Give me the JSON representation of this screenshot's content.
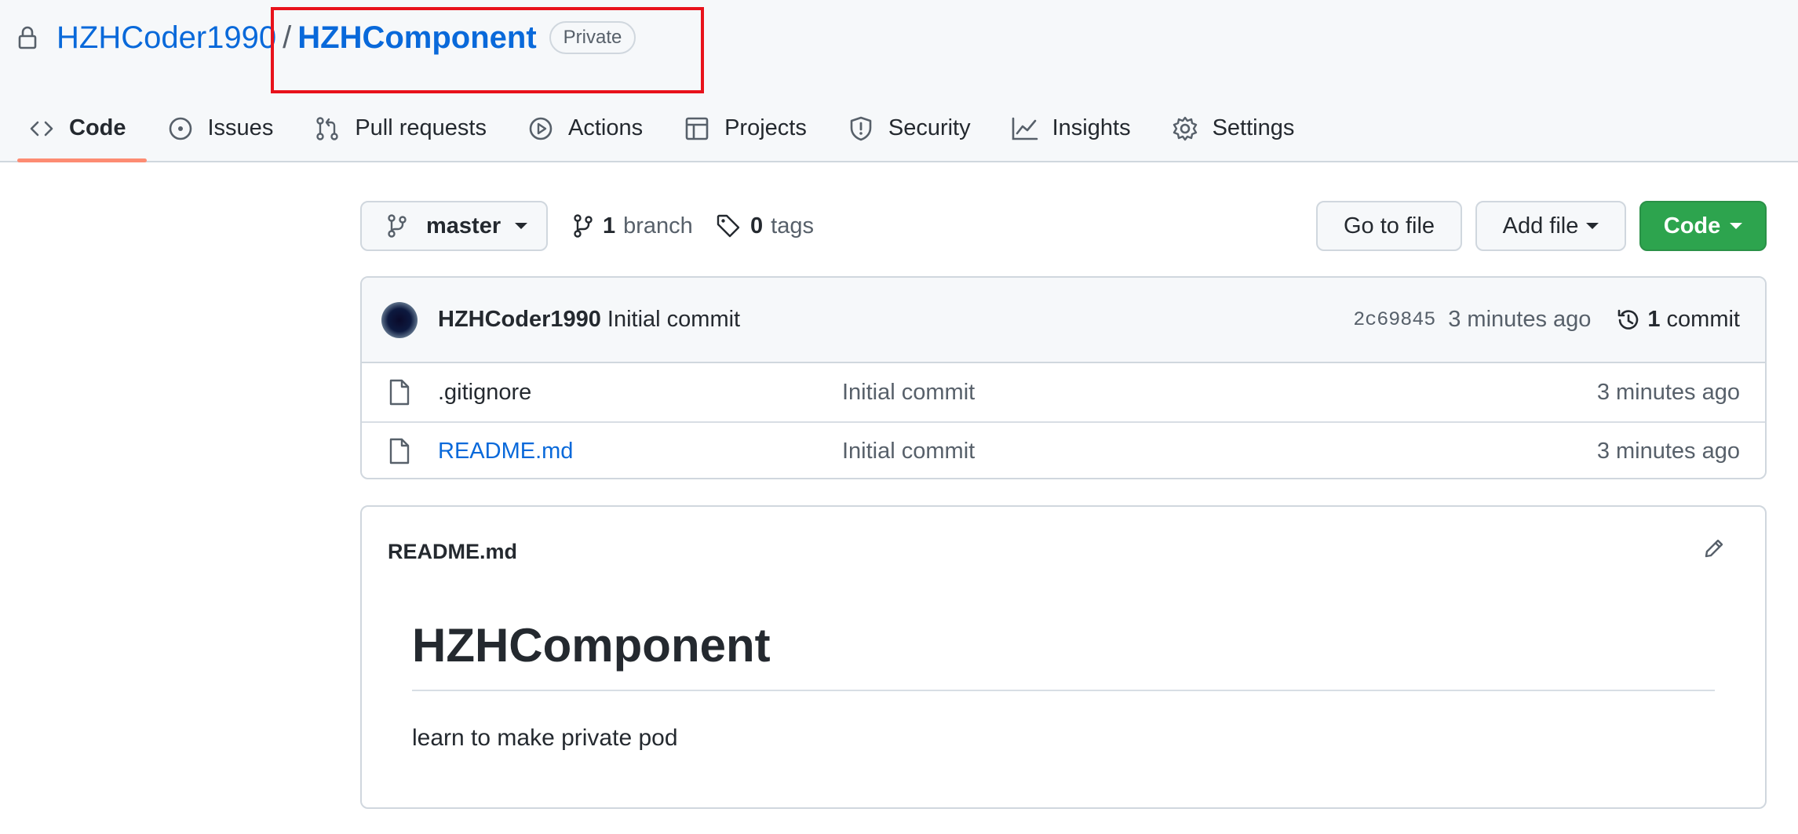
{
  "header": {
    "owner": "HZHCoder1990",
    "separator": "/",
    "repo": "HZHComponent",
    "visibility": "Private"
  },
  "tabs": [
    {
      "label": "Code",
      "icon": "code-icon",
      "active": true
    },
    {
      "label": "Issues",
      "icon": "issue-icon"
    },
    {
      "label": "Pull requests",
      "icon": "pull-request-icon"
    },
    {
      "label": "Actions",
      "icon": "play-icon"
    },
    {
      "label": "Projects",
      "icon": "table-icon"
    },
    {
      "label": "Security",
      "icon": "shield-icon"
    },
    {
      "label": "Insights",
      "icon": "graph-icon"
    },
    {
      "label": "Settings",
      "icon": "gear-icon"
    }
  ],
  "toolbar": {
    "branch": "master",
    "branch_count": "1",
    "branch_label": "branch",
    "tag_count": "0",
    "tag_label": "tags",
    "goto_file": "Go to file",
    "add_file": "Add file",
    "code": "Code"
  },
  "commit": {
    "author": "HZHCoder1990",
    "message": "Initial commit",
    "sha": "2c69845",
    "time": "3 minutes ago",
    "count": "1",
    "count_label": "commit"
  },
  "files": [
    {
      "name": ".gitignore",
      "message": "Initial commit",
      "time": "3 minutes ago"
    },
    {
      "name": "README.md",
      "message": "Initial commit",
      "time": "3 minutes ago"
    }
  ],
  "readme": {
    "filename": "README.md",
    "heading": "HZHComponent",
    "body": "learn to make private pod"
  },
  "colors": {
    "link": "#0969da",
    "code_button": "#2da44e",
    "active_tab_underline": "#fd8c73",
    "highlight_box": "#e8121b"
  }
}
